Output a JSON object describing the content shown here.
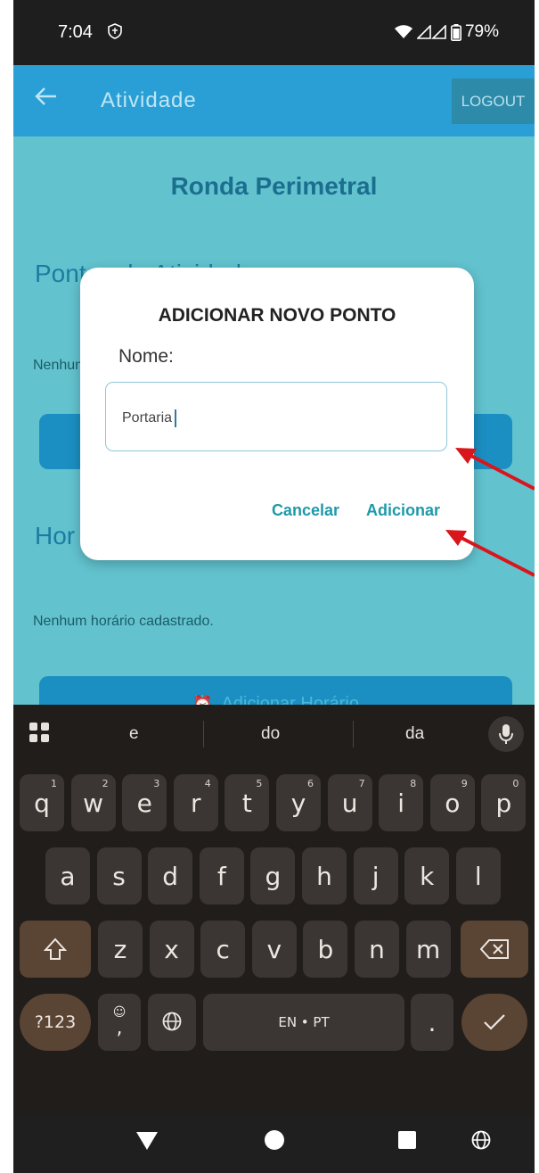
{
  "status_bar": {
    "time": "7:04",
    "battery": "79%"
  },
  "app_bar": {
    "title": "Atividade",
    "logout_label": "LOGOUT"
  },
  "content": {
    "heading": "Ronda Perimetral",
    "points_section_title": "Pontos da Atividade",
    "points_empty": "Nenhum",
    "schedule_section_title": "Hor",
    "schedule_empty": "Nenhum horário cadastrado.",
    "add_schedule_label": "Adicionar Horário"
  },
  "dialog": {
    "title": "ADICIONAR NOVO PONTO",
    "name_label": "Nome:",
    "name_value": "Portaria",
    "cancel_label": "Cancelar",
    "add_label": "Adicionar"
  },
  "keyboard": {
    "suggestions": [
      "e",
      "do",
      "da"
    ],
    "row1": [
      {
        "k": "q",
        "n": "1"
      },
      {
        "k": "w",
        "n": "2"
      },
      {
        "k": "e",
        "n": "3"
      },
      {
        "k": "r",
        "n": "4"
      },
      {
        "k": "t",
        "n": "5"
      },
      {
        "k": "y",
        "n": "6"
      },
      {
        "k": "u",
        "n": "7"
      },
      {
        "k": "i",
        "n": "8"
      },
      {
        "k": "o",
        "n": "9"
      },
      {
        "k": "p",
        "n": "0"
      }
    ],
    "row2": [
      "a",
      "s",
      "d",
      "f",
      "g",
      "h",
      "j",
      "k",
      "l"
    ],
    "row3": [
      "z",
      "x",
      "c",
      "v",
      "b",
      "n",
      "m"
    ],
    "symbols_label": "?123",
    "comma_label": ",",
    "period_label": ".",
    "space_label": "EN • PT"
  }
}
